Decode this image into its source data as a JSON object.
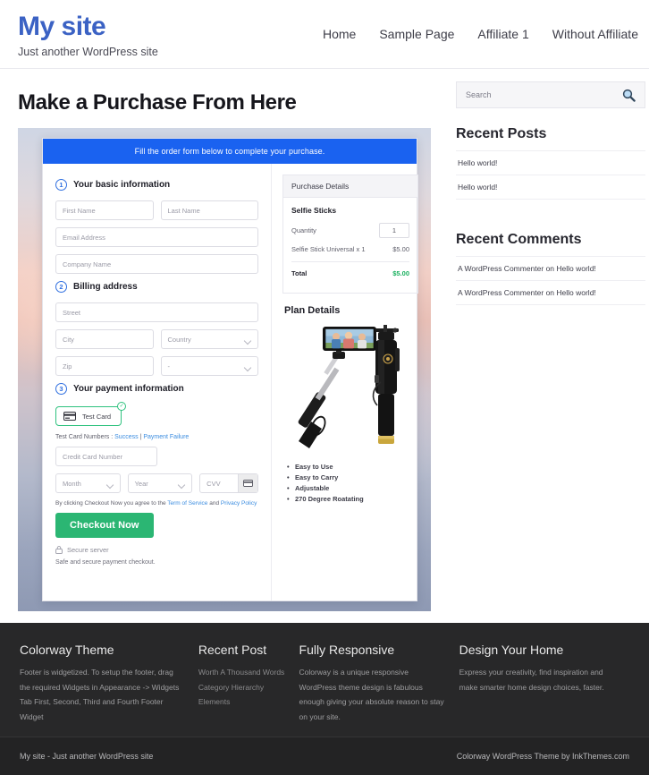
{
  "header": {
    "site_title": "My site",
    "tagline": "Just another WordPress site",
    "nav": [
      {
        "label": "Home"
      },
      {
        "label": "Sample Page"
      },
      {
        "label": "Affiliate 1"
      },
      {
        "label": "Without Affiliate"
      }
    ]
  },
  "page": {
    "title": "Make a Purchase From Here"
  },
  "order": {
    "banner": "Fill the order form below to complete your purchase.",
    "steps": [
      {
        "num": "1",
        "label": "Your basic information"
      },
      {
        "num": "2",
        "label": "Billing address"
      },
      {
        "num": "3",
        "label": "Your payment information"
      }
    ],
    "fields": {
      "first_name": "First Name",
      "last_name": "Last Name",
      "email": "Email Address",
      "company": "Company Name",
      "street": "Street",
      "city": "City",
      "country": "Country",
      "zip": "Zip",
      "state": "-",
      "credit_card": "Credit Card Number",
      "month": "Month",
      "year": "Year",
      "cvv": "CVV"
    },
    "test_card_label": "Test Card",
    "test_numbers_prefix": "Test Card Numbers : ",
    "test_numbers_success": "Success",
    "test_numbers_divider": " | ",
    "test_numbers_failure": "Payment Failure",
    "agree_prefix": "By clicking Checkout Now you agree to the ",
    "agree_tos": "Term of Service",
    "agree_and": " and ",
    "agree_privacy": "Privacy Policy",
    "checkout_button": "Checkout Now",
    "secure_server": "Secure server",
    "safe_note": "Safe and secure payment checkout."
  },
  "summary": {
    "heading": "Purchase Details",
    "product": "Selfie Sticks",
    "quantity_label": "Quantity",
    "quantity_value": "1",
    "line_item_label": "Selfie Stick Universal x 1",
    "line_item_price": "$5.00",
    "total_label": "Total",
    "total_price": "$5.00",
    "plan_title": "Plan Details",
    "features": [
      "Easy to Use",
      "Easy to Carry",
      "Adjustable",
      "270 Degree Roatating"
    ]
  },
  "sidebar": {
    "search_placeholder": "Search",
    "recent_posts_title": "Recent Posts",
    "recent_posts": [
      {
        "label": "Hello world!"
      },
      {
        "label": "Hello world!"
      }
    ],
    "recent_comments_title": "Recent Comments",
    "recent_comments": [
      {
        "label": "A WordPress Commenter on Hello world!"
      },
      {
        "label": "A WordPress Commenter on Hello world!"
      }
    ]
  },
  "footer": {
    "columns": [
      {
        "title": "Colorway Theme",
        "text": "Footer is widgetized. To setup the footer, drag the required Widgets in Appearance -> Widgets Tab First, Second, Third and Fourth Footer Widget"
      },
      {
        "title": "Recent Post",
        "items": [
          {
            "label": "Worth A Thousand Words"
          },
          {
            "label": "Category Hierarchy"
          },
          {
            "label": "Elements"
          }
        ]
      },
      {
        "title": "Fully Responsive",
        "text": "Colorway is a unique responsive WordPress theme design is fabulous enough giving your absolute reason to stay on your site."
      },
      {
        "title": "Design Your Home",
        "text": "Express your creativity, find inspiration and make smarter home design choices, faster."
      }
    ],
    "bottom_left": "My site - Just another WordPress site",
    "bottom_right": "Colorway WordPress Theme by InkThemes.com"
  },
  "colors": {
    "brand_blue": "#3b62c4",
    "banner_blue": "#1a62f0",
    "checkout_green": "#2bb673",
    "price_green": "#18b05e",
    "footer_dark": "#282829"
  }
}
